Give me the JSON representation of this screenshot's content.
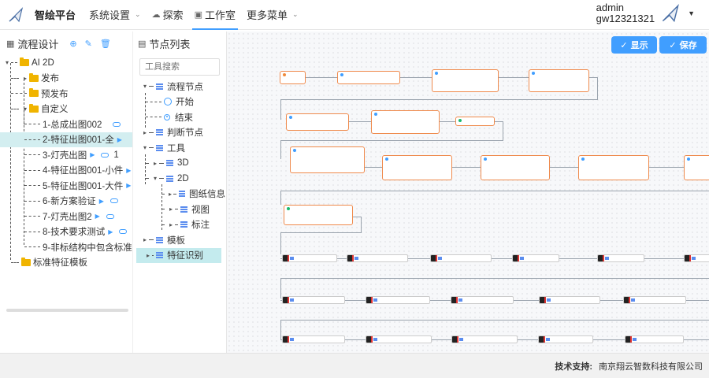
{
  "header": {
    "brand": "智绘平台",
    "nav": [
      {
        "label": "系统设置",
        "has_caret": true
      },
      {
        "label": "探索",
        "icon": "cloud-icon"
      },
      {
        "label": "工作室",
        "icon": "monitor-icon",
        "active": true
      },
      {
        "label": "更多菜单",
        "has_caret": true
      }
    ],
    "user_line1": "admin",
    "user_line2": "gw12321321"
  },
  "left_panel": {
    "title": "流程设计",
    "tree": [
      {
        "label": "AI 2D",
        "level": 0,
        "type": "folder",
        "expanded": true
      },
      {
        "label": "发布",
        "level": 1,
        "type": "folder"
      },
      {
        "label": "预发布",
        "level": 1,
        "type": "folder"
      },
      {
        "label": "自定义",
        "level": 1,
        "type": "folder",
        "expanded": true
      },
      {
        "label": "1-总成出图002",
        "level": 2,
        "type": "flow"
      },
      {
        "label": "2-特征出图001-全",
        "level": 2,
        "type": "flow",
        "selected": true
      },
      {
        "label": "3-灯壳出图",
        "level": 2,
        "type": "flow",
        "badge": "1"
      },
      {
        "label": "4-特征出图001-小件",
        "level": 2,
        "type": "flow"
      },
      {
        "label": "5-特征出图001-大件",
        "level": 2,
        "type": "flow"
      },
      {
        "label": "6-新方案验证",
        "level": 2,
        "type": "flow"
      },
      {
        "label": "7-灯壳出图2",
        "level": 2,
        "type": "flow"
      },
      {
        "label": "8-技术要求测试",
        "level": 2,
        "type": "flow"
      },
      {
        "label": "9-非标结构中包含标准",
        "level": 2,
        "type": "flow"
      },
      {
        "label": "标准特征模板",
        "level": 0,
        "type": "folder"
      }
    ]
  },
  "node_panel": {
    "title": "节点列表",
    "search_placeholder": "工具搜索",
    "items": [
      {
        "label": "流程节点",
        "level": 0,
        "expanded": true
      },
      {
        "label": "开始",
        "level": 1,
        "icon": "power-icon"
      },
      {
        "label": "结束",
        "level": 1,
        "icon": "stop-icon"
      },
      {
        "label": "判断节点",
        "level": 0
      },
      {
        "label": "工具",
        "level": 0,
        "expanded": true
      },
      {
        "label": "3D",
        "level": 1
      },
      {
        "label": "2D",
        "level": 1,
        "expanded": true
      },
      {
        "label": "图纸信息",
        "level": 2
      },
      {
        "label": "视图",
        "level": 2
      },
      {
        "label": "标注",
        "level": 2
      },
      {
        "label": "模板",
        "level": 0
      },
      {
        "label": "特征识别",
        "level": 0,
        "selected": true
      }
    ]
  },
  "canvas": {
    "show_label": "显示",
    "save_label": "保存"
  },
  "footer": {
    "label": "技术支持:",
    "company": "南京翔云智数科技有限公司"
  }
}
